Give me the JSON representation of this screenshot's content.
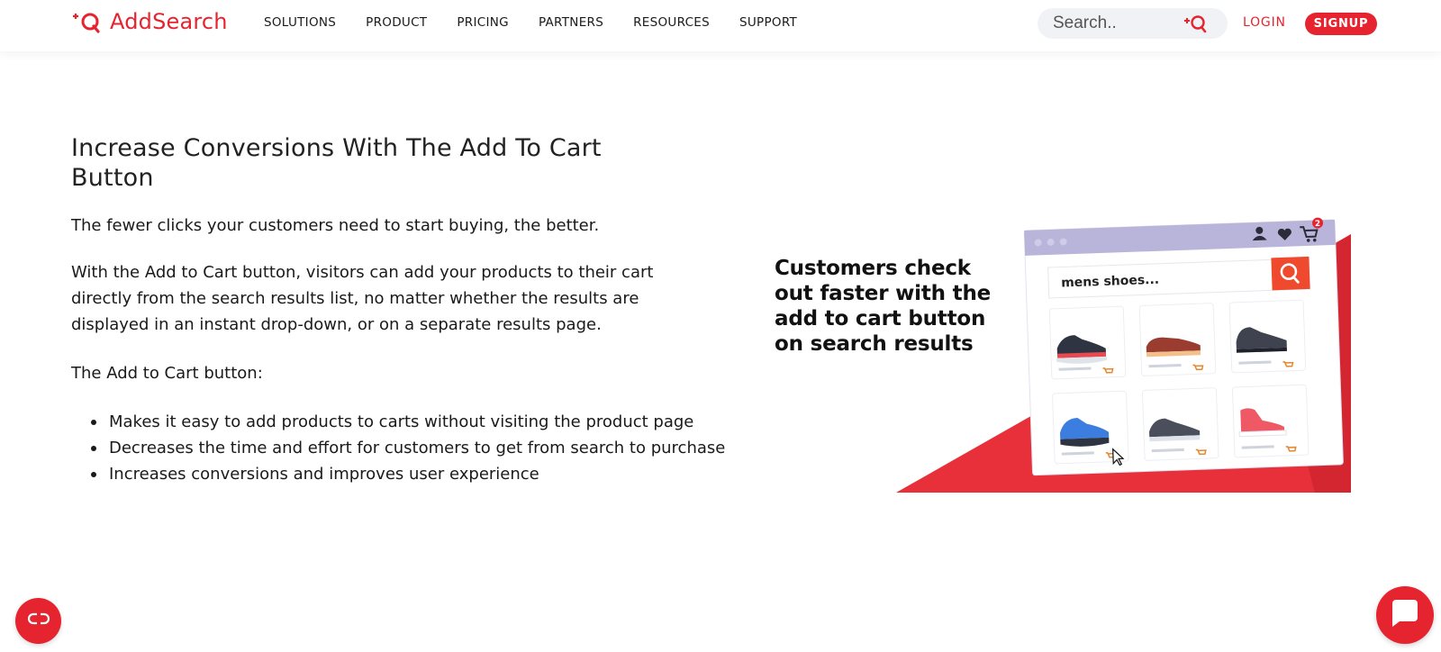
{
  "header": {
    "logo_text": "AddSearch",
    "nav": [
      {
        "label": "SOLUTIONS"
      },
      {
        "label": "PRODUCT"
      },
      {
        "label": "PRICING"
      },
      {
        "label": "PARTNERS"
      },
      {
        "label": "RESOURCES"
      },
      {
        "label": "SUPPORT"
      }
    ],
    "search_placeholder": "Search..",
    "login_label": "LOGIN",
    "signup_label": "SIGNUP"
  },
  "main": {
    "title": "Increase Conversions With The Add To Cart Button",
    "p1": "The fewer clicks your customers need to start buying, the better.",
    "p2": "With the Add to Cart button, visitors can add your products to their cart directly from the search results list, no matter whether the results are displayed in an instant drop-down, or on a separate results page.",
    "p3": "The Add to Cart button:",
    "bullets": [
      "Makes it easy to add products to carts without visiting the product page",
      "Decreases the time and effort for customers to get from search to purchase",
      "Increases conversions and improves user experience"
    ]
  },
  "illustration": {
    "caption": "Customers check out faster with the add to cart button on search results",
    "search_text": "mens shoes...",
    "cart_badge": "2"
  },
  "colors": {
    "brand_red": "#e6242f",
    "window_bar": "#b9b4d9"
  },
  "icons": {
    "logo": "plus-search-logo-icon",
    "search": "plus-search-icon",
    "cookie": "cookie-consent-icon",
    "chat": "chat-bubble-icon"
  }
}
